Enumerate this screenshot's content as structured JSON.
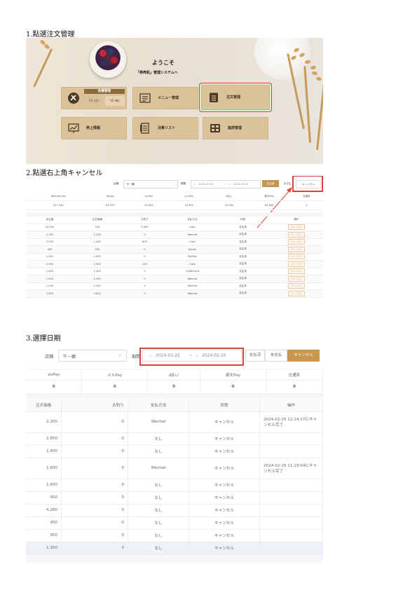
{
  "steps": {
    "step1": "1.點選注文管理",
    "step2": "2.點選右上角キャンセル",
    "step3": "3.選擇日期"
  },
  "screen1": {
    "welcome": "ようこそ",
    "subtitle": "「券売机」管理システムへ",
    "reservation": {
      "title": "約錦管理",
      "v1": "V1 (古)",
      "v2": "V2 (新)"
    },
    "menu": "メニュー管理",
    "order": "注文管理",
    "sales": "売上情報",
    "settlement": "決算リスト",
    "stock": "座席管理"
  },
  "screen2": {
    "store_label": "店舗",
    "store_value": "牛一鵬",
    "period_label": "期間",
    "date_from": "2024-01-26",
    "date_to": "2024-02-25",
    "btn_paid": "支払済",
    "btn_unpaid": "未支払",
    "btn_cancel": "キャンセル",
    "summary_headers": [
      "Wechat pay",
      "Alipay",
      "auPay",
      "メルPay",
      "d払い",
      "楽天Pay",
      "交通系"
    ],
    "summary_values": [
      "327,540",
      "62,570",
      "20,450",
      "10,900",
      "29,560",
      "61,880",
      "0"
    ],
    "table_headers": [
      "支払額",
      "注文価格",
      "お釣り",
      "支払方法",
      "状態",
      "操作"
    ],
    "rows": [
      [
        "10,000",
        "700",
        "9,300",
        "Cash",
        "支払済",
        "キャンセル"
      ],
      [
        "1,100",
        "1,100",
        "0",
        "Wechat",
        "支払済",
        "キャンセル"
      ],
      [
        "2,000",
        "1,400",
        "600",
        "Cash",
        "支払済",
        "キャンセル"
      ],
      [
        "550",
        "550",
        "0",
        "Alipay",
        "支払済",
        "キャンセル"
      ],
      [
        "1,900",
        "1,900",
        "0",
        "PayPay",
        "支払済",
        "キャンセル"
      ],
      [
        "2,095",
        "1,950",
        "145",
        "Cash",
        "支払済",
        "キャンセル"
      ],
      [
        "1,400",
        "1,400",
        "0",
        "CreditCard",
        "支払済",
        "キャンセル"
      ],
      [
        "1,450",
        "1,450",
        "0",
        "Wechat",
        "支払済",
        "キャンセル"
      ],
      [
        "1,050",
        "1,050",
        "0",
        "Wechat",
        "支払済",
        "キャンセル"
      ],
      [
        "2,650",
        "2,650",
        "0",
        "Wechat",
        "支払済",
        "キャンセル"
      ]
    ]
  },
  "screen3": {
    "store_label": "店舗",
    "store_value": "牛一鵬",
    "period_label": "期間",
    "date_from": "2024-01-25",
    "date_to": "2024-02-25",
    "btn_paid": "支払済",
    "btn_unpaid": "未支払",
    "btn_cancel": "キャンセル",
    "summary_headers": [
      "auPay",
      "メルPay",
      "d払い",
      "楽天Pay",
      "交通系"
    ],
    "summary_values": [
      "0",
      "0",
      "0",
      "0",
      "0"
    ],
    "table_headers": [
      "注文価格",
      "お釣り",
      "支払方法",
      "状態",
      "操作"
    ],
    "rows": [
      [
        "2,200",
        "0",
        "Wechat",
        "キャンセル",
        "2024-02-25 12:14:17にキャンセル完了"
      ],
      [
        "2,850",
        "0",
        "なし",
        "キャンセル",
        ""
      ],
      [
        "1,400",
        "0",
        "なし",
        "キャンセル",
        ""
      ],
      [
        "1,600",
        "0",
        "Wechat",
        "キャンセル",
        "2024-02-25 11:19:04にキャンセル完了"
      ],
      [
        "1,600",
        "0",
        "なし",
        "キャンセル",
        ""
      ],
      [
        "950",
        "0",
        "なし",
        "キャンセル",
        ""
      ],
      [
        "4,280",
        "0",
        "なし",
        "キャンセル",
        ""
      ],
      [
        "950",
        "0",
        "なし",
        "キャンセル",
        ""
      ],
      [
        "950",
        "0",
        "なし",
        "キャンセル",
        ""
      ],
      [
        "1,300",
        "0",
        "なし",
        "キャンセル",
        ""
      ]
    ]
  },
  "colors": {
    "accent": "#c8964e",
    "highlight": "#d9453d",
    "tile": "#dcc29a"
  }
}
